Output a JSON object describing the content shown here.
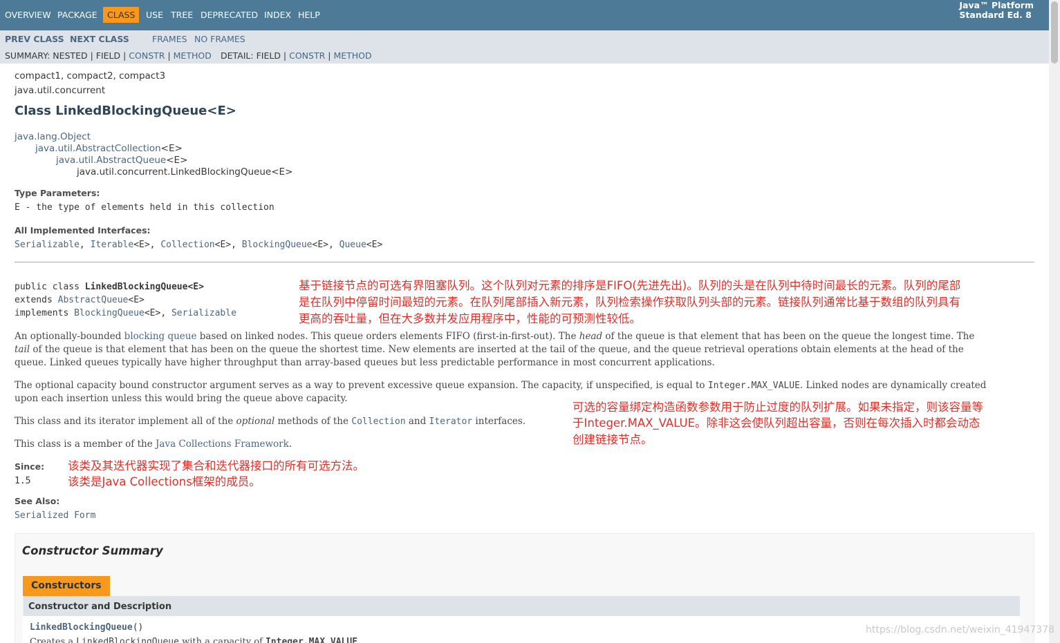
{
  "topnav": {
    "items": [
      "OVERVIEW",
      "PACKAGE",
      "CLASS",
      "USE",
      "TREE",
      "DEPRECATED",
      "INDEX",
      "HELP"
    ],
    "selected": "CLASS",
    "platform_line1": "Java™ Platform",
    "platform_line2": "Standard Ed. 8"
  },
  "subnav": {
    "prev_class": "PREV CLASS",
    "next_class": "NEXT CLASS",
    "frames": "FRAMES",
    "no_frames": "NO FRAMES",
    "summary_prefix": "SUMMARY: NESTED | FIELD | ",
    "summary_constr": "CONSTR",
    "summary_sep": " | ",
    "summary_method": "METHOD",
    "detail_prefix": "DETAIL: FIELD | ",
    "detail_constr": "CONSTR",
    "detail_sep": " | ",
    "detail_method": "METHOD"
  },
  "header": {
    "profiles": "compact1, compact2, compact3",
    "package": "java.util.concurrent",
    "title": "Class LinkedBlockingQueue<E>"
  },
  "inheritance": {
    "l1": "java.lang.Object",
    "l2_link": "java.util.AbstractCollection",
    "l2_suffix": "<E>",
    "l3_link": "java.util.AbstractQueue",
    "l3_suffix": "<E>",
    "l4": "java.util.concurrent.LinkedBlockingQueue<E>"
  },
  "type_params": {
    "label": "Type Parameters:",
    "value": "E - the type of elements held in this collection"
  },
  "interfaces": {
    "label": "All Implemented Interfaces:",
    "i1": "Serializable",
    "sep1": ", ",
    "i2": "Iterable",
    "g2": "<E>, ",
    "i3": "Collection",
    "g3": "<E>, ",
    "i4": "BlockingQueue",
    "g4": "<E>, ",
    "i5": "Queue",
    "g5": "<E>"
  },
  "signature": {
    "line1_prefix": "public class ",
    "line1_name": "LinkedBlockingQueue<E>",
    "line2_prefix": "extends ",
    "line2_link": "AbstractQueue",
    "line2_suffix": "<E>",
    "line3_prefix": "implements ",
    "line3_link1": "BlockingQueue",
    "line3_mid": "<E>, ",
    "line3_link2": "Serializable"
  },
  "annotations": {
    "zh1_l1": "基于链接节点的可选有界阻塞队列。这个队列对元素的排序是FIFO(先进先出)。队列的头是在队列中待时间最长的元素。队列的尾部",
    "zh1_l2": "是在队列中停留时间最短的元素。在队列尾部插入新元素，队列检索操作获取队列头部的元素。链接队列通常比基于数组的队列具有",
    "zh1_l3": "更高的吞吐量，但在大多数并发应用程序中，性能的可预测性较低。",
    "zh2_l1": "可选的容量绑定构造函数参数用于防止过度的队列扩展。如果未指定，则该容量等",
    "zh2_l2": "于Integer.MAX_VALUE。除非这会使队列超出容量，否则在每次插入时都会动态",
    "zh2_l3": "创建链接节点。",
    "zh3": "该类及其迭代器实现了集合和迭代器接口的所有可选方法。",
    "zh4": "该类是Java Collections框架的成员。"
  },
  "description": {
    "p1_l1_a": "An optionally-bounded ",
    "p1_l1_link": "blocking queue",
    "p1_l1_b": " based on linked nodes. This queue orders elements FIFO (first-in-first-out). The ",
    "p1_l1_head": "head",
    "p1_l1_c": " of the queue is that element that has been on the queue the longest time. The",
    "p1_l2_tail": "tail",
    "p1_l2_rest": " of the queue is that element that has been on the queue the shortest time. New elements are inserted at the tail of the queue, and the queue retrieval operations obtain elements at the head of the",
    "p1_l3": "queue. Linked queues typically have higher throughput than array-based queues but less predictable performance in most concurrent applications.",
    "p2_l1_a": "The optional capacity bound constructor argument serves as a way to prevent excessive queue expansion. The capacity, if unspecified, is equal to ",
    "p2_l1_code": "Integer.MAX_VALUE",
    "p2_l1_b": ". Linked nodes are dynamically created",
    "p2_l2": "upon each insertion unless this would bring the queue above capacity.",
    "p3_a": "This class and its iterator implement all of the ",
    "p3_opt": "optional",
    "p3_b": " methods of the ",
    "p3_code1": "Collection",
    "p3_c": " and ",
    "p3_code2": "Iterator",
    "p3_d": " interfaces.",
    "p4_a": "This class is a member of the ",
    "p4_link": "Java Collections Framework",
    "p4_b": "."
  },
  "since": {
    "label": "Since:",
    "value": "1.5"
  },
  "see_also": {
    "label": "See Also:",
    "link": "Serialized Form"
  },
  "constructor_summary": {
    "title": "Constructor Summary",
    "tab": "Constructors",
    "col_header": "Constructor and Description",
    "row_name": "LinkedBlockingQueue",
    "row_parens": "()",
    "row_desc_a": "Creates a ",
    "row_desc_code1": "LinkedBlockingQueue",
    "row_desc_b": " with a capacity of ",
    "row_desc_code2": "Integer.MAX_VALUE",
    "row_desc_c": "."
  },
  "watermark": "https://blog.csdn.net/weixin_41947378"
}
